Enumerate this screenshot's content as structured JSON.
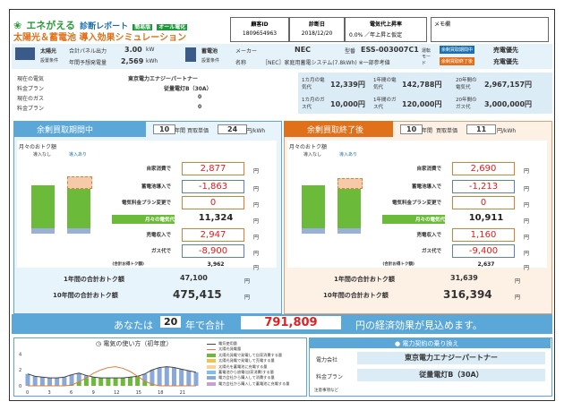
{
  "header": {
    "logo_line1": "エネがえる",
    "logo_line1b": "診断レポート",
    "badge_simple": "簡易版",
    "badge_all": "オール電化",
    "title_main": "太陽光＆蓄電池 導入効果シミュレーション",
    "fields": {
      "agency_id_label": "顧客ID",
      "agency_id": "1809654963",
      "date_label": "診断日",
      "date": "2018/12/20",
      "rate_label": "電気代上昇率",
      "rate": "0.0% ／年上昇と仮定",
      "memo_label": "メモ欄"
    }
  },
  "equipment": {
    "solar_label": "太陽光",
    "solar_sub": "設置条件",
    "panel_label": "合計パネル出力",
    "panel_value": "3.00",
    "panel_unit": "kW",
    "gen_label": "年間予想発電量",
    "gen_value": "2,569",
    "gen_unit": "kWh",
    "battery_label": "蓄電池",
    "battery_sub": "設置条件",
    "maker_label": "メーカー",
    "maker": "NEC",
    "model_label": "型番",
    "model": "ESS-003007C1",
    "name_label": "名称",
    "name": "［NEC］家庭用蓄電システム(7.8kWh) ※一部参考値",
    "mode_label": "運転モード",
    "mode1_tag": "余剰買取期間中",
    "mode1": "売電優先",
    "mode2_tag": "余剰買取終了後",
    "mode2": "充電優先"
  },
  "current": {
    "rows": [
      {
        "label": "現在の電気",
        "value": "東京電力エナジーパートナー"
      },
      {
        "label": "料金プラン",
        "value": "従量電灯B（30A）"
      },
      {
        "label": "現在のガス",
        "value": "0"
      },
      {
        "label": "料金プラン",
        "value": "0"
      }
    ],
    "month_elec_label": "1カ月の電気代",
    "month_elec": "12,339円",
    "year_elec_label": "1年間の電気代",
    "year_elec": "142,788円",
    "twenty_elec_label": "20年間の電気代",
    "twenty_elec": "2,967,157円",
    "month_gas_label": "1カ月のガス代",
    "month_gas": "10,000円",
    "year_gas_label": "1年間のガス代",
    "year_gas": "120,000円",
    "twenty_gas_label": "20年間のガス代",
    "twenty_gas": "3,000,000円"
  },
  "left_panel": {
    "title": "余剰買取期間中",
    "years": "10",
    "years_unit": "年間",
    "price_label": "買取単価",
    "price": "24",
    "price_unit": "円/kWh",
    "chart_title": "月々のおトク額",
    "col_before": "導入なし",
    "col_after": "導入あり",
    "items": [
      {
        "label": "自家消費で",
        "value": "2,877",
        "unit": "円"
      },
      {
        "label": "蓄電池導入で",
        "value": "-1,863",
        "unit": "円"
      },
      {
        "label": "電気料金プラン変更で",
        "value": "0",
        "unit": "円"
      },
      {
        "label": "月々の電気代",
        "value": "11,324",
        "unit": "円"
      },
      {
        "label": "売電収入で",
        "value": "2,947",
        "unit": "円"
      },
      {
        "label": "ガス代で",
        "value": "-8,900",
        "unit": "円"
      },
      {
        "label": "(合計お得トク額)",
        "value": "3,962",
        "unit": "円"
      }
    ],
    "year_label": "1年間の合計おトク額",
    "year_value": "47,100",
    "year_unit": "円",
    "ten_label": "10年間の合計おトク額",
    "ten_value": "475,415",
    "ten_unit": "円"
  },
  "right_panel": {
    "title": "余剰買取終了後",
    "years": "10",
    "years_unit": "年間",
    "price_label": "買取単価",
    "price": "11",
    "price_unit": "円/kWh",
    "chart_title": "月々のおトク額",
    "col_before": "導入なし",
    "col_after": "導入あり",
    "items": [
      {
        "label": "自家消費で",
        "value": "2,690",
        "unit": "円"
      },
      {
        "label": "蓄電池導入で",
        "value": "-1,213",
        "unit": "円"
      },
      {
        "label": "電気料金プラン変更で",
        "value": "0",
        "unit": "円"
      },
      {
        "label": "月々の電気代",
        "value": "10,911",
        "unit": "円"
      },
      {
        "label": "売電収入で",
        "value": "1,160",
        "unit": "円"
      },
      {
        "label": "ガス代で",
        "value": "-9,400",
        "unit": "円"
      },
      {
        "label": "(合計お得トク額)",
        "value": "2,637",
        "unit": "円"
      }
    ],
    "year_label": "1年間の合計おトク額",
    "year_value": "31,639",
    "year_unit": "円",
    "ten_label": "10年間の合計おトク額",
    "ten_value": "316,394",
    "ten_unit": "円"
  },
  "summary": {
    "pre": "あなたは",
    "years": "20",
    "mid": "年で合計",
    "amount": "791,809",
    "post": "円の経済効果が見込めます。"
  },
  "usage": {
    "title": "電気の使い方（初年度）",
    "legend": [
      "電気使用量",
      "太陽光発電量",
      "太陽光発電で発電して自家消費する量",
      "太陽光発電で発電して売電する量",
      "太陽光を蓄電池に充電する量",
      "蓄電池から放電(自家消費)する量",
      "電力会社から購入して消費する量",
      "電力会社から購入して蓄電池に充電する量"
    ],
    "y_ticks": [
      "4",
      "2",
      "0"
    ],
    "x_ticks": [
      "0",
      "3",
      "6",
      "9",
      "12",
      "15",
      "18",
      "21"
    ]
  },
  "contract": {
    "title": "電力契約の乗り換え",
    "company_label": "電力会社",
    "company": "東京電力エナジーパートナー",
    "plan_label": "料金プラン",
    "plan": "従量電灯B（30A）",
    "note": "注意事項など"
  },
  "chart_data": {
    "type": "area",
    "x": [
      0,
      1,
      2,
      3,
      4,
      5,
      6,
      7,
      8,
      9,
      10,
      11,
      12,
      13,
      14,
      15,
      16,
      17,
      18,
      19,
      20,
      21,
      22,
      23
    ],
    "series": [
      {
        "name": "電気使用量",
        "values": [
          1.5,
          1.2,
          1.1,
          1.0,
          1.0,
          1.1,
          1.4,
          1.6,
          1.3,
          1.1,
          1.0,
          1.0,
          1.0,
          1.0,
          1.1,
          1.2,
          1.5,
          2.0,
          2.3,
          2.4,
          2.3,
          2.1,
          1.9,
          1.7
        ]
      },
      {
        "name": "太陽光発電量",
        "values": [
          0,
          0,
          0,
          0,
          0,
          0,
          0.1,
          0.5,
          1.0,
          1.6,
          2.0,
          2.3,
          2.4,
          2.2,
          1.8,
          1.2,
          0.6,
          0.2,
          0,
          0,
          0,
          0,
          0,
          0
        ]
      }
    ],
    "ylim": [
      0,
      4.5
    ]
  }
}
